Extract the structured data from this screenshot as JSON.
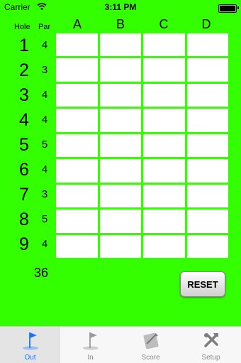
{
  "status_bar": {
    "carrier": "Carrier",
    "time": "3:11 PM"
  },
  "header": {
    "hole_label": "Hole",
    "par_label": "Par",
    "players": [
      "A",
      "B",
      "C",
      "D"
    ]
  },
  "holes": [
    {
      "number": "1",
      "par": "4"
    },
    {
      "number": "2",
      "par": "3"
    },
    {
      "number": "3",
      "par": "4"
    },
    {
      "number": "4",
      "par": "4"
    },
    {
      "number": "5",
      "par": "5"
    },
    {
      "number": "6",
      "par": "4"
    },
    {
      "number": "7",
      "par": "3"
    },
    {
      "number": "8",
      "par": "5"
    },
    {
      "number": "9",
      "par": "4"
    }
  ],
  "total_par": "36",
  "reset_label": "RESET",
  "tabs": [
    {
      "label": "Out",
      "icon": "flag-icon",
      "active": true
    },
    {
      "label": "In",
      "icon": "flag-icon",
      "active": false
    },
    {
      "label": "Score",
      "icon": "scorecard-icon",
      "active": false
    },
    {
      "label": "Setup",
      "icon": "tools-icon",
      "active": false
    }
  ],
  "colors": {
    "background": "#33ff00",
    "active_tab": "#1a73ff"
  }
}
